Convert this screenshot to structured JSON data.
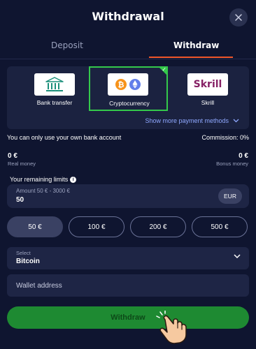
{
  "header": {
    "title": "Withdrawal"
  },
  "tabs": [
    {
      "label": "Deposit",
      "active": false
    },
    {
      "label": "Withdraw",
      "active": true
    }
  ],
  "payment_methods": {
    "items": [
      {
        "label": "Bank transfer",
        "icon": "bank-icon",
        "selected": false
      },
      {
        "label": "Cryptocurrency",
        "icon": "crypto-icon",
        "selected": true
      },
      {
        "label": "Skrill",
        "icon": "skrill-logo",
        "logo_text": "Skrill",
        "selected": false
      }
    ],
    "show_more_label": "Show more payment methods"
  },
  "info": {
    "notice": "You can only use your own bank account",
    "commission": "Commission: 0%"
  },
  "balances": {
    "real": {
      "value": "0 €",
      "label": "Real money"
    },
    "bonus": {
      "value": "0 €",
      "label": "Bonus money"
    }
  },
  "limits": {
    "label": "Your remaining limits"
  },
  "amount": {
    "placeholder": "Amount 50 € - 3000 €",
    "value": "50",
    "currency": "EUR"
  },
  "presets": [
    {
      "label": "50 €",
      "active": true
    },
    {
      "label": "100 €",
      "active": false
    },
    {
      "label": "200 €",
      "active": false
    },
    {
      "label": "500 €",
      "active": false
    }
  ],
  "select": {
    "placeholder": "Select",
    "value": "Bitcoin"
  },
  "wallet": {
    "placeholder": "Wallet address"
  },
  "submit": {
    "label": "Withdraw"
  },
  "colors": {
    "background": "#0f1530",
    "accent_tab": "#f0562a",
    "selected_border": "#34c94b",
    "submit": "#1e8a32",
    "link": "#8fa8ff"
  }
}
